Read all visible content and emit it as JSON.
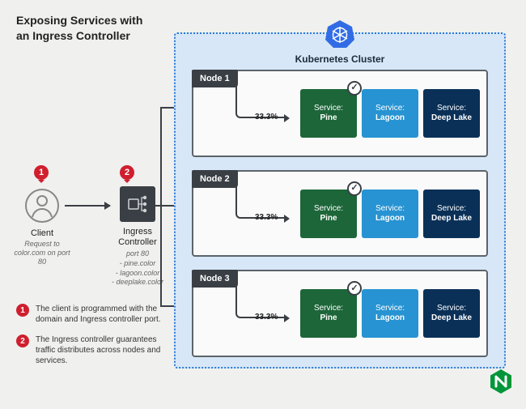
{
  "title_line1": "Exposing Services with",
  "title_line2": "an Ingress Controller",
  "cluster_title": "Kubernetes Cluster",
  "node_label_prefix": "Node",
  "percentage": "33.3%",
  "service_prefix": "Service:",
  "services": {
    "pine": "Pine",
    "lagoon": "Lagoon",
    "deeplake": "Deep Lake"
  },
  "client": {
    "label": "Client",
    "sub": "Request to color.com on port 80"
  },
  "ingress": {
    "label": "Ingress Controller",
    "port": "port 80",
    "routes": [
      "- pine.color",
      "- lagoon.color",
      "- deeplake.color"
    ]
  },
  "markers": {
    "m1": "1",
    "m2": "2"
  },
  "legend": [
    {
      "n": "1",
      "text": "The client is programmed with the domain and Ingress controller port."
    },
    {
      "n": "2",
      "text": "The Ingress controller guarantees traffic distributes across nodes and services."
    }
  ],
  "nodes": [
    "Node 1",
    "Node 2",
    "Node 3"
  ],
  "colors": {
    "pine": "#1d6639",
    "lagoon": "#2793d2",
    "deeplake": "#0a3057",
    "cluster_border": "#2b7bd4",
    "marker": "#cf1f2e",
    "brand": "#009639"
  }
}
